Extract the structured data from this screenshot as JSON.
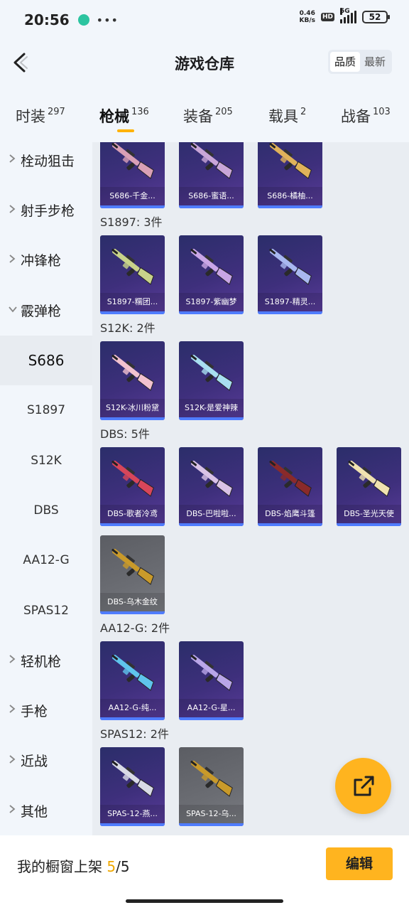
{
  "status_bar": {
    "time": "20:56",
    "more": "•••",
    "net_speed_value": "0.46",
    "net_speed_unit": "KB/s",
    "hd": "HD",
    "network": "5G",
    "battery": "52"
  },
  "header": {
    "title": "游戏仓库",
    "sort_options": [
      "品质",
      "最新"
    ],
    "active_sort": "品质"
  },
  "category_tabs": [
    {
      "label": "时装",
      "count": "297"
    },
    {
      "label": "枪械",
      "count": "136"
    },
    {
      "label": "装备",
      "count": "205"
    },
    {
      "label": "载具",
      "count": "2"
    },
    {
      "label": "战备",
      "count": "103"
    }
  ],
  "active_category": "枪械",
  "sidebar": [
    {
      "label": "栓动狙击",
      "type": "group"
    },
    {
      "label": "射手步枪",
      "type": "group"
    },
    {
      "label": "冲锋枪",
      "type": "group"
    },
    {
      "label": "霰弹枪",
      "type": "group-open"
    },
    {
      "label": "S686",
      "type": "sub"
    },
    {
      "label": "S1897",
      "type": "sub"
    },
    {
      "label": "S12K",
      "type": "sub"
    },
    {
      "label": "DBS",
      "type": "sub"
    },
    {
      "label": "AA12-G",
      "type": "sub"
    },
    {
      "label": "SPAS12",
      "type": "sub"
    },
    {
      "label": "轻机枪",
      "type": "group"
    },
    {
      "label": "手枪",
      "type": "group"
    },
    {
      "label": "近战",
      "type": "group"
    },
    {
      "label": "其他",
      "type": "group"
    }
  ],
  "active_sidebar": "S686",
  "sections": [
    {
      "title": "",
      "items": [
        {
          "name": "S686-千金...",
          "style": "purple",
          "color": "#d9a0b6"
        },
        {
          "name": "S686-蜜语...",
          "style": "purple",
          "color": "#c9a6d8"
        },
        {
          "name": "S686-橘柚...",
          "style": "purple",
          "color": "#e0b25a"
        }
      ]
    },
    {
      "title": "S1897: 3件",
      "items": [
        {
          "name": "S1897-糯团...",
          "style": "purple",
          "color": "#c9d38a"
        },
        {
          "name": "S1897-紫幽梦",
          "style": "purple",
          "color": "#c9a6e6"
        },
        {
          "name": "S1897-精灵...",
          "style": "purple",
          "color": "#a9b8f0"
        }
      ]
    },
    {
      "title": "S12K: 2件",
      "items": [
        {
          "name": "S12K-冰川粉黛",
          "style": "purple",
          "color": "#f2c2cf"
        },
        {
          "name": "S12K-是爱神辣",
          "style": "purple",
          "color": "#a8dff0"
        }
      ]
    },
    {
      "title": "DBS: 5件",
      "items": [
        {
          "name": "DBS-歌者冷鸢",
          "style": "purple",
          "color": "#d8465a"
        },
        {
          "name": "DBS-巴啦啦...",
          "style": "purple",
          "color": "#d9c2e6"
        },
        {
          "name": "DBS-焰鹰斗篷",
          "style": "purple",
          "color": "#8a2a2a"
        },
        {
          "name": "DBS-圣光天使",
          "style": "purple",
          "color": "#f0e2b0"
        },
        {
          "name": "DBS-乌木金纹",
          "style": "gray",
          "color": "#c99a2a"
        }
      ]
    },
    {
      "title": "AA12-G: 2件",
      "items": [
        {
          "name": "AA12-G-纯...",
          "style": "purple",
          "color": "#5fc4ec"
        },
        {
          "name": "AA12-G-星...",
          "style": "purple",
          "color": "#b9a6e8"
        }
      ]
    },
    {
      "title": "SPAS12: 2件",
      "items": [
        {
          "name": "SPAS-12-燕...",
          "style": "purple",
          "color": "#d9dbe6"
        },
        {
          "name": "SPAS-12-乌...",
          "style": "gray",
          "color": "#c99a2a"
        }
      ]
    }
  ],
  "bottom": {
    "showcase_label": "我的橱窗上架",
    "showcase_current": "5",
    "showcase_total": "/5",
    "edit_label": "编辑"
  }
}
